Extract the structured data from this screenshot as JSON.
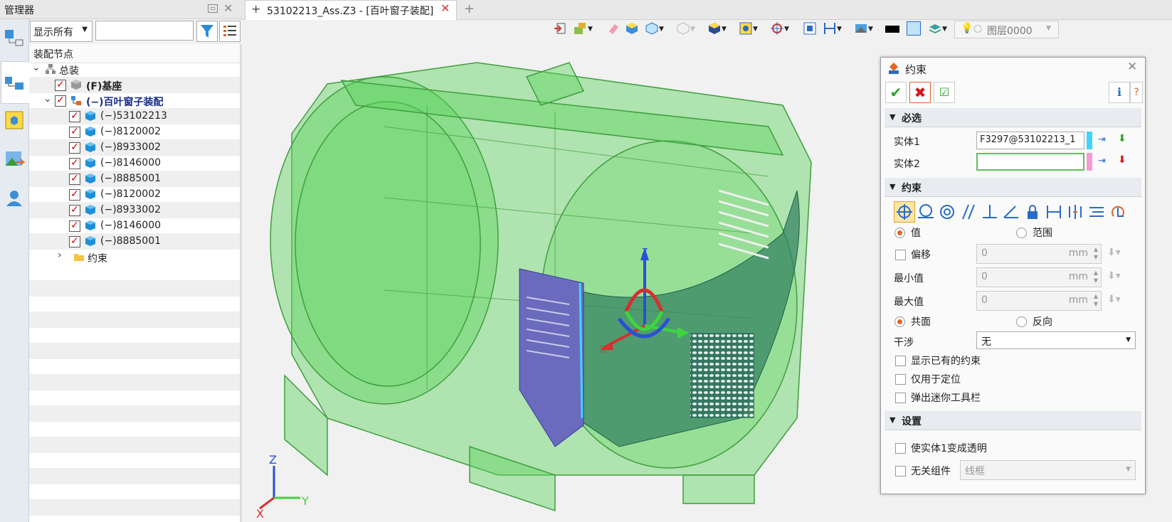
{
  "manager": {
    "title": "管理器",
    "display_filter": "显示所有",
    "search_placeholder": "",
    "tree_header": "装配节点",
    "tree": [
      {
        "label": "总装",
        "level": 0,
        "checked": false
      },
      {
        "label": "(F)基座",
        "level": 1,
        "checked": true
      },
      {
        "label": "(−)百叶窗子装配",
        "level": 1,
        "checked": true
      },
      {
        "label": "(−)53102213",
        "level": 2,
        "checked": true
      },
      {
        "label": "(−)8120002",
        "level": 2,
        "checked": true
      },
      {
        "label": "(−)8933002",
        "level": 2,
        "checked": true
      },
      {
        "label": "(−)8146000",
        "level": 2,
        "checked": true
      },
      {
        "label": "(−)8885001",
        "level": 2,
        "checked": true
      },
      {
        "label": "(−)8120002",
        "level": 2,
        "checked": true
      },
      {
        "label": "(−)8933002",
        "level": 2,
        "checked": true
      },
      {
        "label": "(−)8146000",
        "level": 2,
        "checked": true
      },
      {
        "label": "(−)8885001",
        "level": 2,
        "checked": true
      },
      {
        "label": "约束",
        "level": 2,
        "checked": false
      }
    ]
  },
  "document_tab": {
    "title": "53102213_Ass.Z3 - [百叶窗子装配]"
  },
  "toolbar": {
    "layer_label": "图层0000"
  },
  "constraint_dialog": {
    "title": "约束",
    "section_required": "必选",
    "entity1_label": "实体1",
    "entity1_value": "F3297@53102213_1",
    "entity2_label": "实体2",
    "entity2_value": "",
    "section_constraint": "约束",
    "radio_value": "值",
    "radio_range": "范围",
    "offset_label": "偏移",
    "min_label": "最小值",
    "max_label": "最大值",
    "offset_value": "0",
    "min_value": "0",
    "max_value": "0",
    "unit": "mm",
    "radio_coplanar": "共面",
    "radio_reverse": "反向",
    "interference_label": "干涉",
    "interference_value": "无",
    "chk_show_existing": "显示已有的约束",
    "chk_position_only": "仅用于定位",
    "chk_mini_toolbar": "弹出迷你工具栏",
    "section_settings": "设置",
    "chk_transparent": "使实体1变成透明",
    "chk_unrelated": "无关组件",
    "unrelated_value": "线框"
  },
  "axes": {
    "x": "X",
    "y": "Y",
    "z": "Z"
  },
  "colors": {
    "part_green": "#5fd35f",
    "accent_blue": "#2b6cc4",
    "check_red": "#d01818"
  }
}
